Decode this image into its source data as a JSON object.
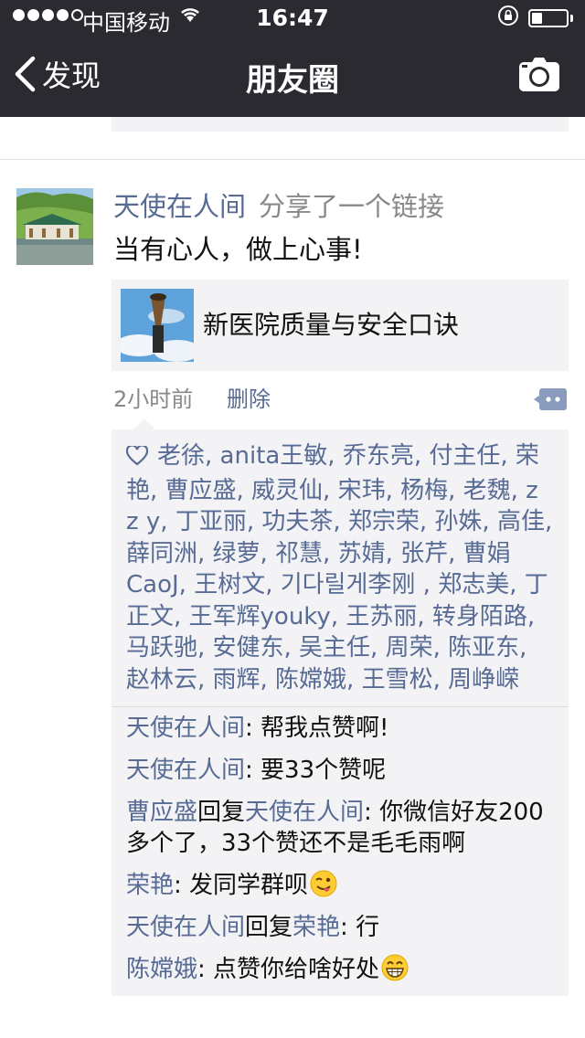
{
  "status_bar": {
    "carrier": "中国移动",
    "time": "16:47",
    "battery_level": 0.3
  },
  "nav": {
    "back_label": "发现",
    "title": "朋友圈",
    "camera_icon": "camera-icon"
  },
  "post": {
    "author": "天使在人间",
    "action": "分享了一个链接",
    "text": "当有心人，做上心事!",
    "link": {
      "title": "新医院质量与安全口诀"
    },
    "time": "2小时前",
    "delete_label": "删除",
    "likes": "老徐, anita王敏, 乔东亮, 付主任, 荣艳, 曹应盛, 威灵仙, 宋玮, 杨梅, 老魏, z z y, 丁亚丽, 功夫茶, 郑宗荣, 孙姝, 高佳, 薛同洲, 绿萝, 祁慧, 苏婧, 张芹, 曹娟CaoJ, 王树文, 기다릴게李刚 , 郑志美, 丁正文, 王军辉youky, 王苏丽, 转身陌路, 马跃驰, 安健东, 吴主任, 周荣, 陈亚东, 赵林云, 雨辉, 陈嫦娥, 王雪松, 周峥嵘",
    "comments": [
      {
        "name": "天使在人间",
        "reply_word": "",
        "reply_to": "",
        "text": ": 帮我点赞啊!"
      },
      {
        "name": "天使在人间",
        "reply_word": "",
        "reply_to": "",
        "text": ": 要33个赞呢"
      },
      {
        "name": "曹应盛",
        "reply_word": "回复",
        "reply_to": "天使在人间",
        "text": ": 你微信好友200多个了，33个赞还不是毛毛雨啊"
      },
      {
        "name": "荣艳",
        "reply_word": "",
        "reply_to": "",
        "text": ": 发同学群呗"
      },
      {
        "name": "天使在人间",
        "reply_word": "回复",
        "reply_to": "荣艳",
        "text": ": 行"
      },
      {
        "name": "陈嫦娥",
        "reply_word": "",
        "reply_to": "",
        "text": ": 点赞你给啥好处"
      }
    ]
  },
  "colors": {
    "nav_bg": "#2b2a30",
    "link_blue": "#576b95",
    "panel_bg": "#f3f3f5"
  }
}
